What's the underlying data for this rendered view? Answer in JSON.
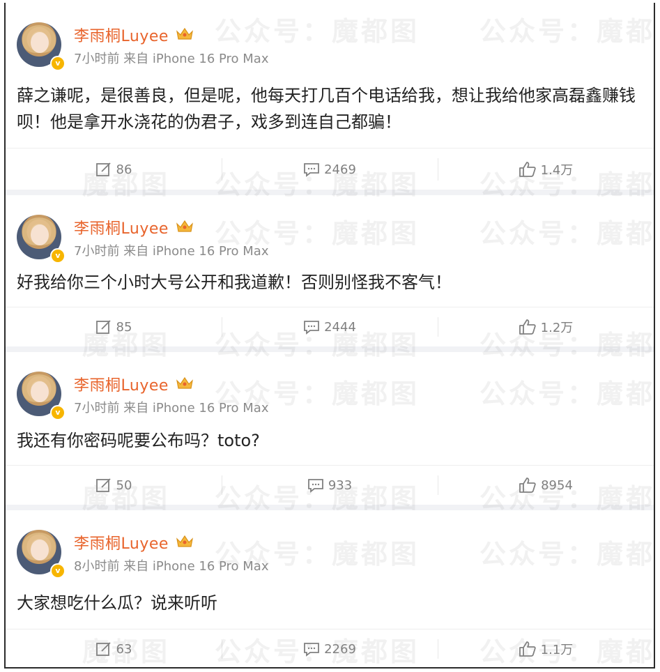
{
  "watermark": {
    "text_a": "公众号：",
    "text_b": "魔都图"
  },
  "posts": [
    {
      "user": "李雨桐Luyee",
      "meta": "7小时前 来自 iPhone 16 Pro Max",
      "content": "薛之谦呢，是很善良，但是呢，他每天打几百个电话给我，想让我给他家高磊鑫赚钱呗！他是拿开水浇花的伪君子，戏多到连自己都骗！",
      "repost": "86",
      "comment": "2469",
      "like": "1.4万"
    },
    {
      "user": "李雨桐Luyee",
      "meta": "7小时前 来自 iPhone 16 Pro Max",
      "content": "好我给你三个小时大号公开和我道歉！否则别怪我不客气！",
      "repost": "85",
      "comment": "2444",
      "like": "1.2万"
    },
    {
      "user": "李雨桐Luyee",
      "meta": "7小时前 来自 iPhone 16 Pro Max",
      "content": "我还有你密码呢要公布吗？toto?",
      "repost": "50",
      "comment": "933",
      "like": "8954"
    },
    {
      "user": "李雨桐Luyee",
      "meta": "8小时前 来自 iPhone 16 Pro Max",
      "content": "大家想吃什么瓜？说来听听",
      "repost": "63",
      "comment": "2269",
      "like": "1.1万"
    }
  ],
  "colors": {
    "username": "#e8642c",
    "meta": "#8a8a8a",
    "action": "#808080",
    "verified": "#f7b500"
  },
  "icons": {
    "repost": "repost-icon",
    "comment": "comment-icon",
    "like": "like-icon",
    "crown": "crown-badge-icon",
    "verified": "verified-icon"
  }
}
